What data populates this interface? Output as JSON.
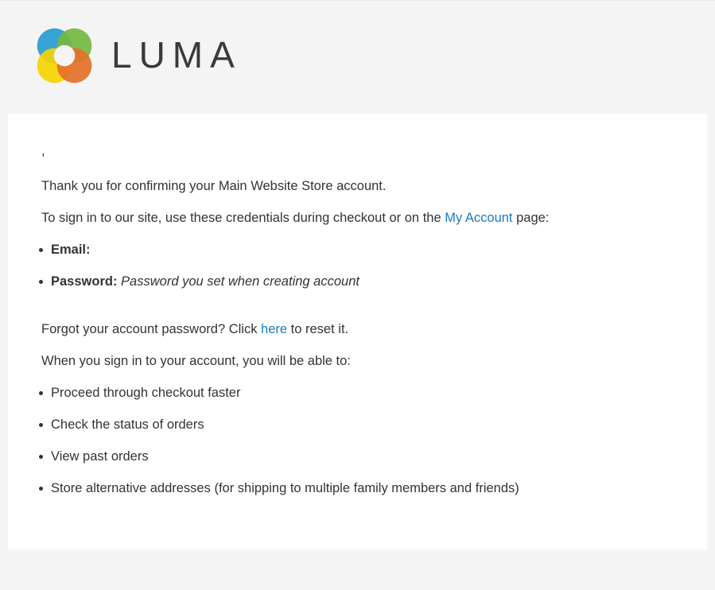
{
  "header": {
    "logo_icon": "luma-flower-logo-icon",
    "brand_name": "LUMA",
    "colors": {
      "logo_blue": "#29a3dc",
      "logo_green": "#79c143",
      "logo_yellow": "#ffdd00",
      "logo_orange": "#f0762b",
      "wordmark": "#3a3a3a"
    }
  },
  "page": {
    "background_color": "#f4f4f4",
    "panel_background_color": "#ffffff",
    "text_color": "#333333",
    "link_color": "#1979c3"
  },
  "body": {
    "greeting": ",",
    "thank_you": "Thank you for confirming your Main Website Store account.",
    "signin_intro_before_link": "To sign in to our site, use these credentials during checkout or on the ",
    "signin_link_label": "My Account",
    "signin_intro_after_link": " page:",
    "credentials": [
      {
        "label": "Email:",
        "value": ""
      },
      {
        "label": "Password:",
        "value": "Password you set when creating account"
      }
    ],
    "forgot_before_link": "Forgot your account password? Click ",
    "forgot_link_label": "here",
    "forgot_after_link": " to reset it.",
    "benefits_intro": "When you sign in to your account, you will be able to:",
    "benefits": [
      "Proceed through checkout faster",
      "Check the status of orders",
      "View past orders",
      "Store alternative addresses (for shipping to multiple family members and friends)"
    ]
  }
}
